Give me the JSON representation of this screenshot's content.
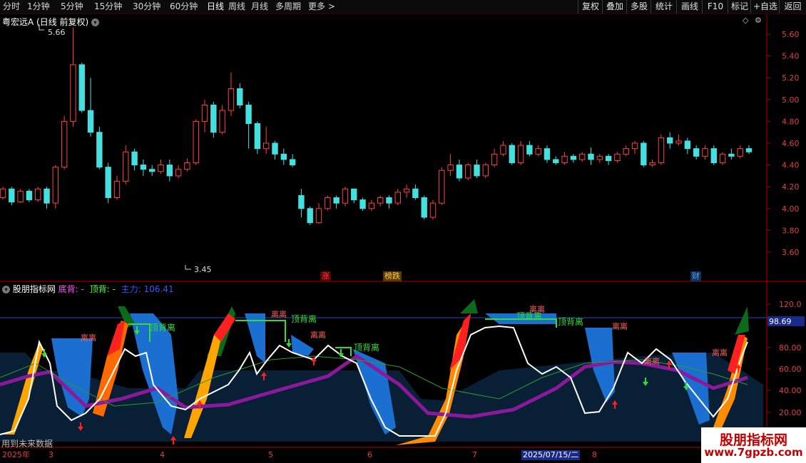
{
  "toolbar": {
    "periods": [
      "分时",
      "1分钟",
      "5分钟",
      "15分钟",
      "30分钟",
      "60分钟",
      "日线",
      "周线",
      "月线",
      "多周期",
      "更多 >"
    ],
    "buttons": [
      "复权",
      "叠加",
      "多股",
      "统计",
      "画线",
      "F10",
      "标记",
      "+自选",
      "返回"
    ]
  },
  "stock": {
    "name": "粤宏远A",
    "period_label": "(日线 前复权)",
    "high_label": "5.66",
    "low_label": "3.45"
  },
  "price_axis": [
    "5.60",
    "5.40",
    "5.20",
    "5.00",
    "4.80",
    "4.60",
    "4.40",
    "4.20",
    "4.00",
    "3.80",
    "3.60"
  ],
  "event_badges": [
    {
      "text": "涨",
      "color": "#ff4040"
    },
    {
      "text": "榜跌",
      "color": "#ffcc44"
    },
    {
      "text": "财",
      "color": "#4fa0ff"
    }
  ],
  "indicator": {
    "name": "股朋指标网",
    "legend": [
      {
        "text": "底背: -",
        "color": "#ff55ff"
      },
      {
        "text": "顶背: -",
        "color": "#55ff55"
      },
      {
        "text": "主力: 106.41",
        "color": "#3355ff"
      }
    ],
    "axis": [
      "120.0",
      "80.00",
      "60.00",
      "40.00",
      "20.00"
    ],
    "current_value": "98.69",
    "annotations": {
      "top_divergence": "顶背离",
      "sell": "离离"
    },
    "future_note": "用到未来数据"
  },
  "dates": {
    "labels": [
      "2025年",
      "3",
      "4",
      "5",
      "6",
      "7",
      "2025/07/15/二",
      "8"
    ],
    "highlight_color": "#4466ff"
  },
  "watermark": {
    "title": "股朋指标网",
    "url": "www.7gpzb.com"
  },
  "chart_data": {
    "type": "candlestick",
    "ylim": [
      3.45,
      5.7
    ],
    "up_color": "#ff4040",
    "down_color": "#44e0e0",
    "candles": [
      [
        4.1,
        4.18,
        4.08,
        4.2
      ],
      [
        4.18,
        4.06,
        4.03,
        4.2
      ],
      [
        4.06,
        4.16,
        4.05,
        4.18
      ],
      [
        4.16,
        4.08,
        4.06,
        4.18
      ],
      [
        4.08,
        4.18,
        4.06,
        4.2
      ],
      [
        4.18,
        4.05,
        4.0,
        4.2
      ],
      [
        4.05,
        4.38,
        4.0,
        4.4
      ],
      [
        4.38,
        4.8,
        4.36,
        4.85
      ],
      [
        4.8,
        5.32,
        4.75,
        5.66
      ],
      [
        5.32,
        4.9,
        4.88,
        5.34
      ],
      [
        4.9,
        4.7,
        4.66,
        5.2
      ],
      [
        4.7,
        4.38,
        4.36,
        4.75
      ],
      [
        4.38,
        4.1,
        4.05,
        4.42
      ],
      [
        4.1,
        4.25,
        4.08,
        4.3
      ],
      [
        4.25,
        4.52,
        4.22,
        4.58
      ],
      [
        4.52,
        4.4,
        4.35,
        4.55
      ],
      [
        4.4,
        4.36,
        4.3,
        4.45
      ],
      [
        4.36,
        4.34,
        4.3,
        4.4
      ],
      [
        4.34,
        4.4,
        4.32,
        4.45
      ],
      [
        4.4,
        4.3,
        4.25,
        4.45
      ],
      [
        4.3,
        4.36,
        4.28,
        4.4
      ],
      [
        4.36,
        4.42,
        4.34,
        4.46
      ],
      [
        4.42,
        4.8,
        4.4,
        4.82
      ],
      [
        4.8,
        4.95,
        4.7,
        5.0
      ],
      [
        4.95,
        4.7,
        4.65,
        4.98
      ],
      [
        4.7,
        4.9,
        4.68,
        4.95
      ],
      [
        4.9,
        5.1,
        4.85,
        5.25
      ],
      [
        5.1,
        4.95,
        4.92,
        5.15
      ],
      [
        4.95,
        4.78,
        4.55,
        4.98
      ],
      [
        4.78,
        4.55,
        4.5,
        4.8
      ],
      [
        4.55,
        4.6,
        4.5,
        4.75
      ],
      [
        4.6,
        4.5,
        4.45,
        4.62
      ],
      [
        4.5,
        4.45,
        4.4,
        4.55
      ],
      [
        4.45,
        4.4,
        4.38,
        4.5
      ],
      [
        4.12,
        4.0,
        3.92,
        4.18
      ],
      [
        4.0,
        3.87,
        3.85,
        4.02
      ],
      [
        3.87,
        4.0,
        3.86,
        4.05
      ],
      [
        4.0,
        4.1,
        3.98,
        4.12
      ],
      [
        4.1,
        4.05,
        4.0,
        4.12
      ],
      [
        4.05,
        4.18,
        4.02,
        4.2
      ],
      [
        4.18,
        4.08,
        4.05,
        4.18
      ],
      [
        4.08,
        4.0,
        3.98,
        4.1
      ],
      [
        4.0,
        4.05,
        3.98,
        4.08
      ],
      [
        4.05,
        4.1,
        4.02,
        4.12
      ],
      [
        4.1,
        4.05,
        4.0,
        4.12
      ],
      [
        4.05,
        4.15,
        4.03,
        4.18
      ],
      [
        4.15,
        4.18,
        4.1,
        4.22
      ],
      [
        4.18,
        4.1,
        4.08,
        4.22
      ],
      [
        4.1,
        3.92,
        3.9,
        4.12
      ],
      [
        3.92,
        4.05,
        3.9,
        4.08
      ],
      [
        4.05,
        4.35,
        4.03,
        4.38
      ],
      [
        4.35,
        4.4,
        4.3,
        4.5
      ],
      [
        4.4,
        4.28,
        4.25,
        4.45
      ],
      [
        4.28,
        4.4,
        4.26,
        4.42
      ],
      [
        4.4,
        4.3,
        4.28,
        4.45
      ],
      [
        4.3,
        4.4,
        4.28,
        4.42
      ],
      [
        4.4,
        4.5,
        4.38,
        4.55
      ],
      [
        4.5,
        4.58,
        4.48,
        4.62
      ],
      [
        4.58,
        4.42,
        4.4,
        4.6
      ],
      [
        4.42,
        4.58,
        4.4,
        4.62
      ],
      [
        4.58,
        4.5,
        4.48,
        4.62
      ],
      [
        4.5,
        4.55,
        4.48,
        4.58
      ],
      [
        4.55,
        4.45,
        4.42,
        4.58
      ],
      [
        4.45,
        4.42,
        4.4,
        4.48
      ],
      [
        4.42,
        4.48,
        4.4,
        4.52
      ],
      [
        4.48,
        4.45,
        4.42,
        4.5
      ],
      [
        4.45,
        4.5,
        4.43,
        4.52
      ],
      [
        4.5,
        4.45,
        4.4,
        4.56
      ],
      [
        4.45,
        4.48,
        4.42,
        4.5
      ],
      [
        4.48,
        4.44,
        4.4,
        4.5
      ],
      [
        4.44,
        4.5,
        4.42,
        4.52
      ],
      [
        4.5,
        4.55,
        4.48,
        4.58
      ],
      [
        4.55,
        4.6,
        4.5,
        4.62
      ],
      [
        4.6,
        4.4,
        4.38,
        4.62
      ],
      [
        4.4,
        4.42,
        4.38,
        4.45
      ],
      [
        4.42,
        4.65,
        4.4,
        4.68
      ],
      [
        4.65,
        4.6,
        4.55,
        4.7
      ],
      [
        4.6,
        4.62,
        4.58,
        4.68
      ],
      [
        4.62,
        4.55,
        4.5,
        4.65
      ],
      [
        4.55,
        4.48,
        4.45,
        4.58
      ],
      [
        4.48,
        4.55,
        4.45,
        4.58
      ],
      [
        4.55,
        4.42,
        4.4,
        4.58
      ],
      [
        4.42,
        4.5,
        4.4,
        4.52
      ],
      [
        4.5,
        4.48,
        4.45,
        4.55
      ],
      [
        4.48,
        4.55,
        4.46,
        4.58
      ],
      [
        4.55,
        4.52,
        4.5,
        4.58
      ]
    ]
  }
}
